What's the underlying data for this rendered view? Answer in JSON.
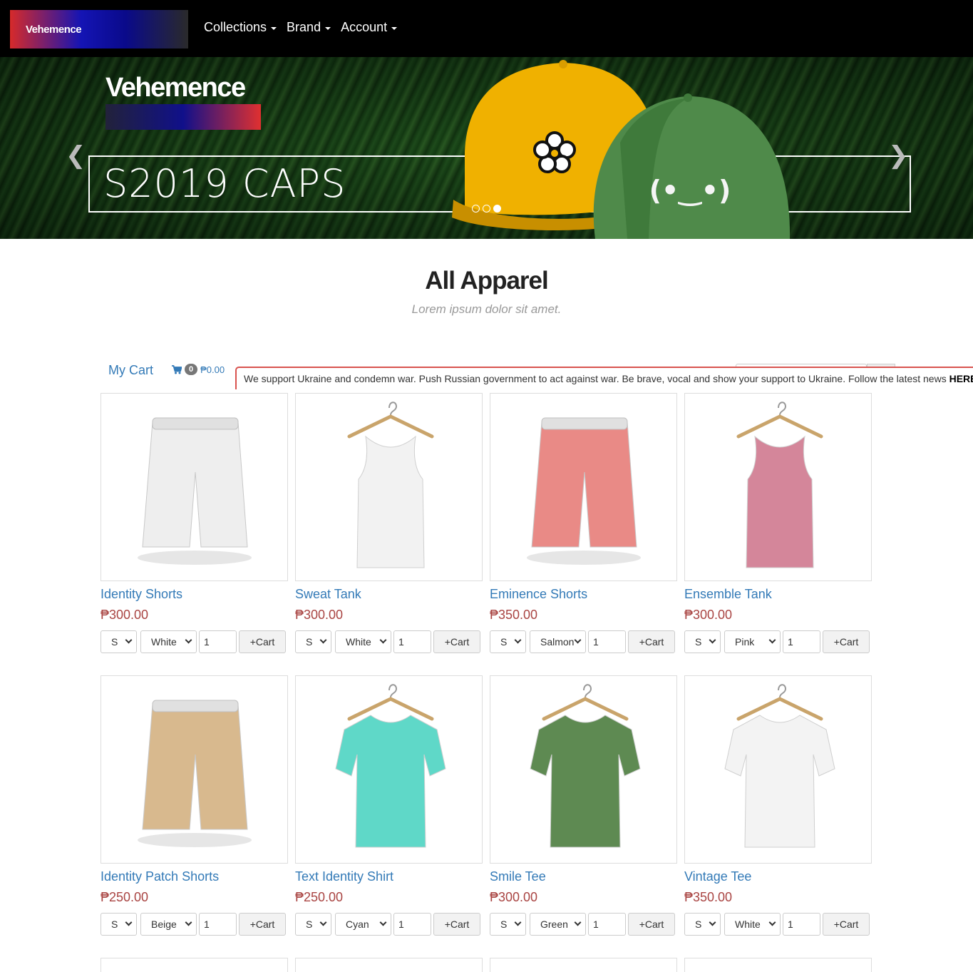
{
  "navbar": {
    "brand": "Vehemence",
    "menu": [
      {
        "label": "Collections"
      },
      {
        "label": "Brand"
      },
      {
        "label": "Account"
      }
    ]
  },
  "hero": {
    "logo_text": "Vehemence",
    "caption": "S2019 CAPS",
    "slides_total": 3,
    "active_slide": 3,
    "prev_icon": "chevron-left-icon",
    "next_icon": "chevron-right-icon",
    "cap_face": "(•‿•)"
  },
  "section": {
    "title": "All Apparel",
    "subtitle": "Lorem ipsum dolor sit amet."
  },
  "cart": {
    "label": "My Cart",
    "icon": "shopping-cart-icon",
    "count": "0",
    "total": "₱0.00"
  },
  "notice": {
    "text": "We support Ukraine and condemn war. Push Russian government to act against war. Be brave, vocal and show your support to Ukraine. Follow the latest news ",
    "link": "HERE"
  },
  "colors": {
    "accent_link": "#337ab7",
    "price": "#a94442",
    "notice_border": "#d9534f"
  },
  "products": [
    {
      "name": "Identity Shorts",
      "price": "₱300.00",
      "size": "S",
      "color": "White",
      "qty": "1",
      "button": "+Cart",
      "kind": "shorts",
      "fabric": "#eeeeee"
    },
    {
      "name": "Sweat Tank",
      "price": "₱300.00",
      "size": "S",
      "color": "White",
      "qty": "1",
      "button": "+Cart",
      "kind": "tank",
      "fabric": "#f2f2f2"
    },
    {
      "name": "Eminence Shorts",
      "price": "₱350.00",
      "size": "S",
      "color": "Salmon",
      "qty": "1",
      "button": "+Cart",
      "kind": "shorts",
      "fabric": "#e98a86"
    },
    {
      "name": "Ensemble Tank",
      "price": "₱300.00",
      "size": "S",
      "color": "Pink",
      "qty": "1",
      "button": "+Cart",
      "kind": "tank",
      "fabric": "#d4869a"
    },
    {
      "name": "Identity Patch Shorts",
      "price": "₱250.00",
      "size": "S",
      "color": "Beige",
      "qty": "1",
      "button": "+Cart",
      "kind": "shorts",
      "fabric": "#d8b98e"
    },
    {
      "name": "Text Identity Shirt",
      "price": "₱250.00",
      "size": "S",
      "color": "Cyan",
      "qty": "1",
      "button": "+Cart",
      "kind": "tee",
      "fabric": "#5fd8c8"
    },
    {
      "name": "Smile Tee",
      "price": "₱300.00",
      "size": "S",
      "color": "Green",
      "qty": "1",
      "button": "+Cart",
      "kind": "tee",
      "fabric": "#5e8a52"
    },
    {
      "name": "Vintage Tee",
      "price": "₱350.00",
      "size": "S",
      "color": "White",
      "qty": "1",
      "button": "+Cart",
      "kind": "tee",
      "fabric": "#f3f3f3"
    }
  ]
}
